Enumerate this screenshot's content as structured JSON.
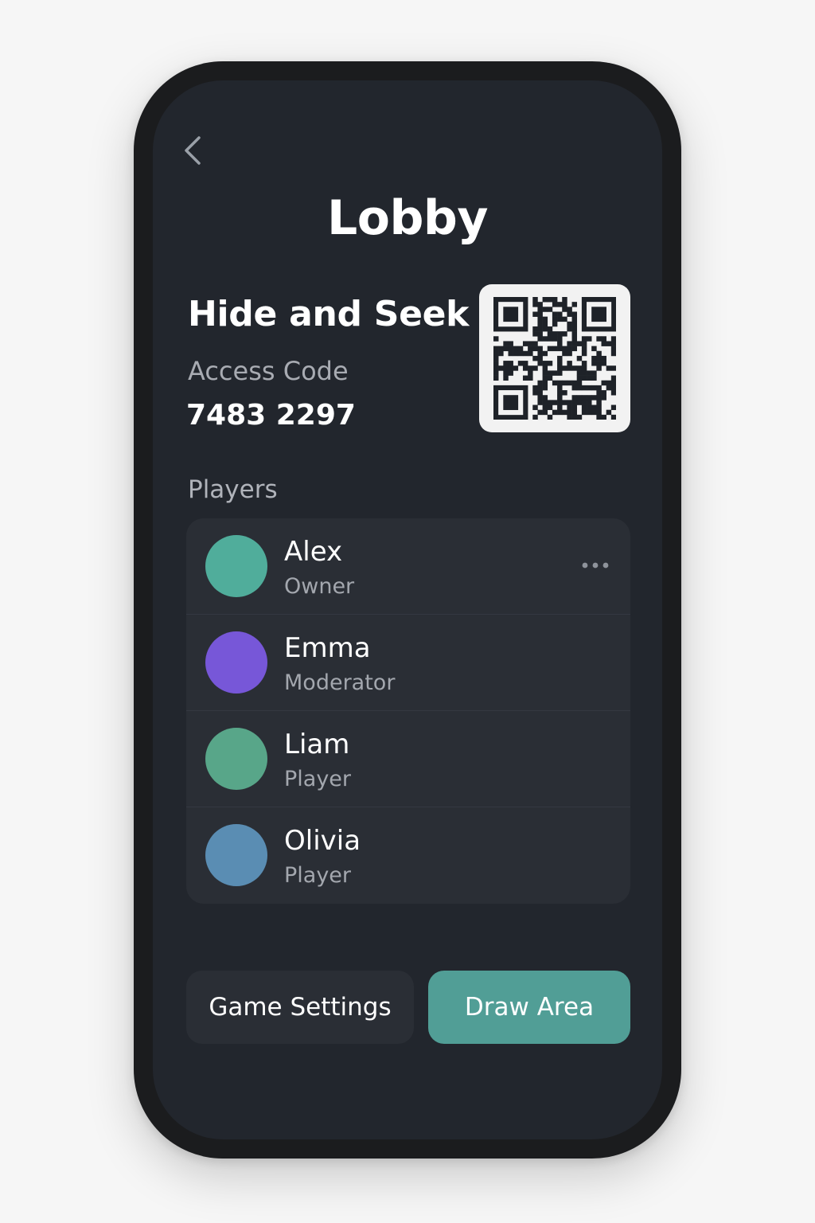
{
  "header": {
    "back_icon": "chevron-left-icon",
    "title": "Lobby"
  },
  "game": {
    "name": "Hide and Seek",
    "access_code_label": "Access Code",
    "access_code": "7483 2297",
    "qr_icon": "qr-code-icon"
  },
  "players": {
    "label": "Players",
    "items": [
      {
        "name": "Alex",
        "role": "Owner",
        "avatar_color": "#50ad9b",
        "has_menu": true
      },
      {
        "name": "Emma",
        "role": "Moderator",
        "avatar_color": "#7757d8"
      },
      {
        "name": "Liam",
        "role": "Player",
        "avatar_color": "#58a689"
      },
      {
        "name": "Olivia",
        "role": "Player",
        "avatar_color": "#5a8db3"
      }
    ],
    "menu_icon": "more-horizontal-icon"
  },
  "actions": {
    "secondary_label": "Game Settings",
    "primary_label": "Draw Area",
    "primary_color": "#519e96"
  }
}
